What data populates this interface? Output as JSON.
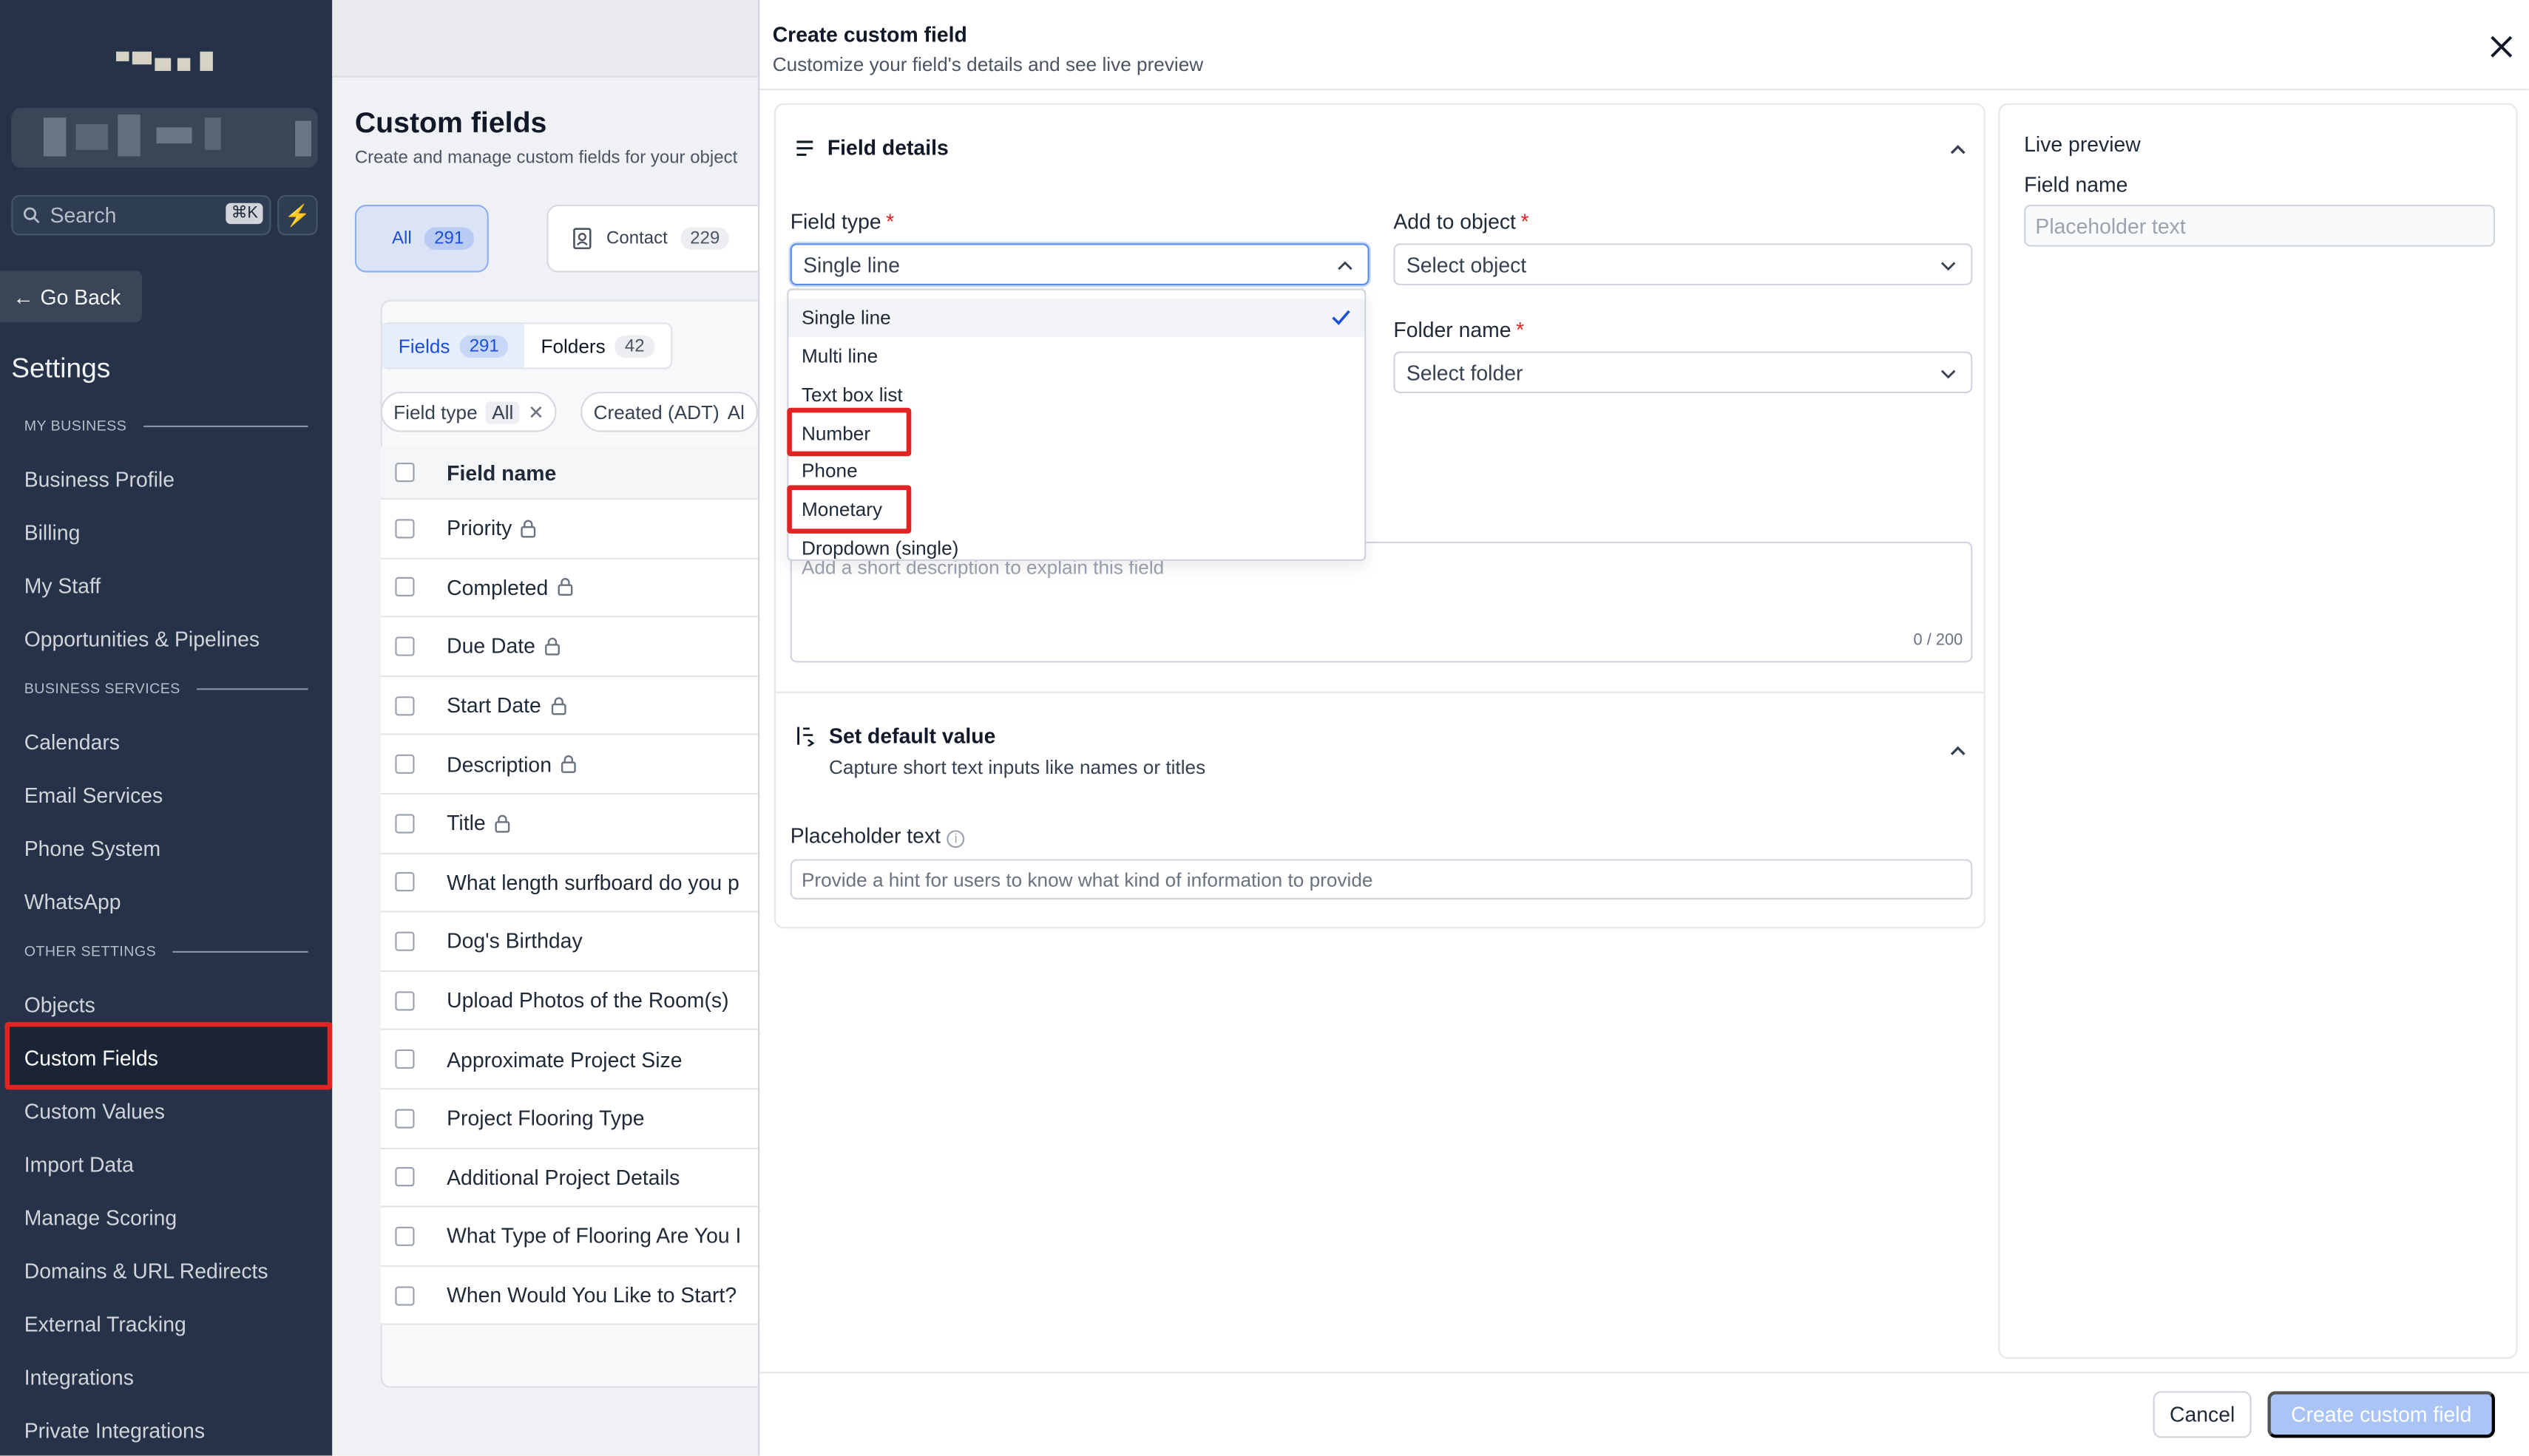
{
  "sidebar": {
    "search_placeholder": "Search",
    "search_shortcut": "⌘K",
    "go_back": "Go Back",
    "title": "Settings",
    "sections": [
      {
        "label": "MY BUSINESS",
        "items": [
          "Business Profile",
          "Billing",
          "My Staff",
          "Opportunities & Pipelines"
        ]
      },
      {
        "label": "BUSINESS SERVICES",
        "items": [
          "Calendars",
          "Email Services",
          "Phone System",
          "WhatsApp"
        ]
      },
      {
        "label": "OTHER SETTINGS",
        "items": [
          "Objects",
          "Custom Fields",
          "Custom Values",
          "Import Data",
          "Manage Scoring",
          "Domains & URL Redirects",
          "External Tracking",
          "Integrations",
          "Private Integrations"
        ]
      }
    ],
    "active_item": "Custom Fields",
    "highlight_color": "#e02424"
  },
  "main": {
    "title": "Custom fields",
    "subtitle": "Create and manage custom fields for your object",
    "object_tabs": [
      {
        "label": "All",
        "count": "291"
      },
      {
        "label": "Contact",
        "count": "229"
      }
    ],
    "subtabs": [
      {
        "label": "Fields",
        "count": "291"
      },
      {
        "label": "Folders",
        "count": "42"
      }
    ],
    "filters": [
      {
        "label": "Field type",
        "value": "All"
      },
      {
        "label": "Created (ADT)",
        "value": "Al"
      }
    ],
    "table": {
      "header": "Field name",
      "rows": [
        {
          "name": "Priority",
          "locked": true
        },
        {
          "name": "Completed",
          "locked": true
        },
        {
          "name": "Due Date",
          "locked": true
        },
        {
          "name": "Start Date",
          "locked": true
        },
        {
          "name": "Description",
          "locked": true
        },
        {
          "name": "Title",
          "locked": true
        },
        {
          "name": "What length surfboard do you p",
          "locked": false
        },
        {
          "name": "Dog's Birthday",
          "locked": false
        },
        {
          "name": "Upload Photos of the Room(s)",
          "locked": false
        },
        {
          "name": "Approximate Project Size",
          "locked": false
        },
        {
          "name": "Project Flooring Type",
          "locked": false
        },
        {
          "name": "Additional Project Details",
          "locked": false
        },
        {
          "name": "What Type of Flooring Are You I",
          "locked": false
        },
        {
          "name": "When Would You Like to Start?",
          "locked": false
        }
      ]
    }
  },
  "modal": {
    "title": "Create custom field",
    "subtitle": "Customize your field's details and see live preview",
    "field_details": {
      "heading": "Field details",
      "field_type_label": "Field type",
      "field_type_value": "Single line",
      "add_to_object_label": "Add to object",
      "add_to_object_placeholder": "Select object",
      "folder_name_label": "Folder name",
      "folder_placeholder": "Select folder",
      "description_placeholder": "Add a short description to explain this field",
      "description_count": "0 / 200"
    },
    "dropdown_options": [
      "Single line",
      "Multi line",
      "Text box list",
      "Number",
      "Phone",
      "Monetary",
      "Dropdown (single)"
    ],
    "dropdown_selected": "Single line",
    "highlighted_options": [
      "Number",
      "Monetary"
    ],
    "default_value": {
      "heading": "Set default value",
      "subheading": "Capture short text inputs like names or titles",
      "placeholder_label": "Placeholder text",
      "placeholder_hint": "Provide a hint for users to know what kind of information to provide"
    },
    "preview": {
      "title": "Live preview",
      "field_label": "Field name",
      "input_placeholder": "Placeholder text"
    },
    "buttons": {
      "cancel": "Cancel",
      "create": "Create custom field"
    },
    "accent_color": "#5b8def"
  }
}
